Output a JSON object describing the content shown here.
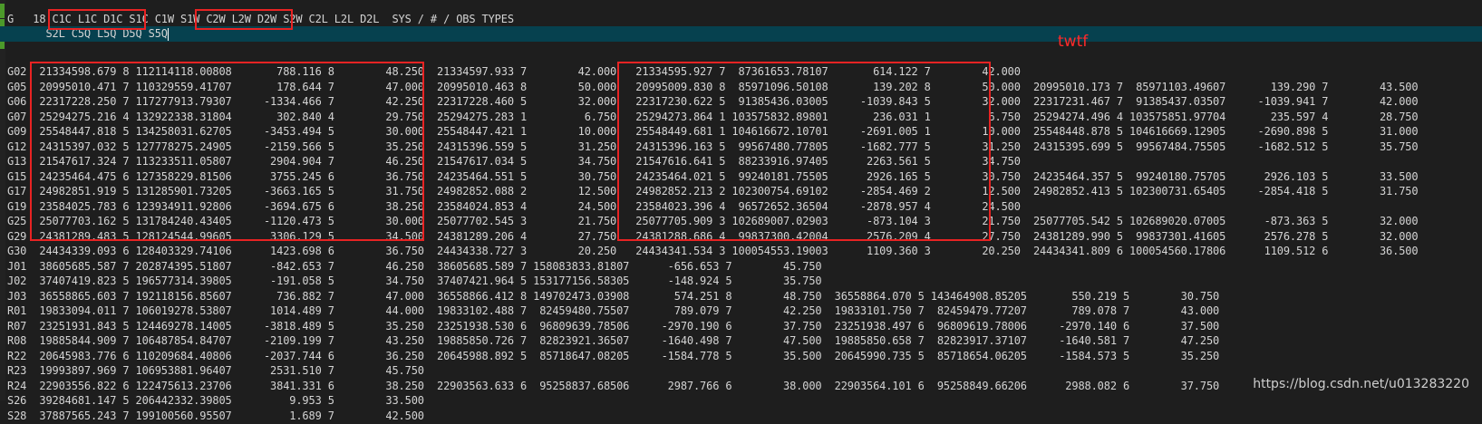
{
  "header": {
    "line1": "G   18 C1C L1C D1C S1C C1W S1W C2W L2W D2W S2W C2L L2L D2L  SYS / # / OBS TYPES",
    "line2": "      S2L C5Q L5Q D5Q S5Q"
  },
  "annotation": "twtf",
  "watermark": "https://blog.csdn.net/u013283220",
  "rows": [
    "G02  21334598.679 8 112114118.00808       788.116 8        48.250  21334597.933 7        42.000   21334595.927 7  87361653.78107       614.122 7        42.000",
    "G05  20995010.471 7 110329559.41707       178.644 7        47.000  20995010.463 8        50.000   20995009.830 8  85971096.50108       139.202 8        50.000  20995010.173 7  85971103.49607       139.290 7        43.500",
    "G06  22317228.250 7 117277913.79307     -1334.466 7        42.250  22317228.460 5        32.000   22317230.622 5  91385436.03005     -1039.843 5        32.000  22317231.467 7  91385437.03507     -1039.941 7        42.000",
    "G07  25294275.216 4 132922338.31804       302.840 4        29.750  25294275.283 1         6.750   25294273.864 1 103575832.89801       236.031 1         6.750  25294274.496 4 103575851.97704       235.597 4        28.750",
    "G09  25548447.818 5 134258031.62705     -3453.494 5        30.000  25548447.421 1        10.000   25548449.681 1 104616672.10701     -2691.005 1        10.000  25548448.878 5 104616669.12905     -2690.898 5        31.000",
    "G12  24315397.032 5 127778275.24905     -2159.566 5        35.250  24315396.559 5        31.250   24315396.163 5  99567480.77805     -1682.777 5        31.250  24315395.699 5  99567484.75505     -1682.512 5        35.750",
    "G13  21547617.324 7 113233511.05807      2904.904 7        46.250  21547617.034 5        34.750   21547616.641 5  88233916.97405      2263.561 5        34.750",
    "G15  24235464.475 6 127358229.81506      3755.245 6        36.750  24235464.551 5        30.750   24235464.021 5  99240181.75505      2926.165 5        30.750  24235464.357 5  99240180.75705      2926.103 5        33.500",
    "G17  24982851.919 5 131285901.73205     -3663.165 5        31.750  24982852.088 2        12.500   24982852.213 2 102300754.69102     -2854.469 2        12.500  24982852.413 5 102300731.65405     -2854.418 5        31.750",
    "G19  23584025.783 6 123934911.92806     -3694.675 6        38.250  23584024.853 4        24.500   23584023.396 4  96572652.36504     -2878.957 4        24.500",
    "G25  25077703.162 5 131784240.43405     -1120.473 5        30.000  25077702.545 3        21.750   25077705.909 3 102689007.02903      -873.104 3        21.750  25077705.542 5 102689020.07005      -873.363 5        32.000",
    "G29  24381289.483 5 128124544.99605      3306.129 5        34.500  24381289.206 4        27.750   24381288.686 4  99837300.42004      2576.209 4        27.750  24381289.990 5  99837301.41605      2576.278 5        32.000",
    "G30  24434339.093 6 128403329.74106      1423.698 6        36.750  24434338.727 3        20.250   24434341.534 3 100054553.19003      1109.360 3        20.250  24434341.809 6 100054560.17806      1109.512 6        36.500",
    "J01  38605685.587 7 202874395.51807      -842.653 7        46.250  38605685.589 7 158083833.81807      -656.653 7        45.750",
    "J02  37407419.823 5 196577314.39805      -191.058 5        34.750  37407421.964 5 153177156.58305      -148.924 5        35.750",
    "J03  36558865.603 7 192118156.85607       736.882 7        47.000  36558866.412 8 149702473.03908       574.251 8        48.750  36558864.070 5 143464908.85205       550.219 5        30.750",
    "R01  19833094.011 7 106019278.53807      1014.489 7        44.000  19833102.488 7  82459480.75507       789.079 7        42.250  19833101.750 7  82459479.77207       789.078 7        43.000",
    "R07  23251931.843 5 124469278.14005     -3818.489 5        35.250  23251938.530 6  96809639.78506     -2970.190 6        37.750  23251938.497 6  96809619.78006     -2970.140 6        37.500",
    "R08  19885844.909 7 106487854.84707     -2109.199 7        43.250  19885850.726 7  82823921.36507     -1640.498 7        47.500  19885850.658 7  82823917.37107     -1640.581 7        47.250",
    "R22  20645983.776 6 110209684.40806     -2037.744 6        36.250  20645988.892 5  85718647.08205     -1584.778 5        35.500  20645990.735 5  85718654.06205     -1584.573 5        35.250",
    "R23  19993897.969 7 106953881.96407      2531.510 7        45.750",
    "R24  22903556.822 6 122475613.23706      3841.331 6        38.250  22903563.633 6  95258837.68506      2987.766 6        38.000  22903564.101 6  95258849.66206      2988.082 6        37.750",
    "S26  39284681.147 5 206442332.39805         9.953 5        33.500",
    "S28  37887565.243 7 199100560.95507         1.689 7        42.500"
  ]
}
